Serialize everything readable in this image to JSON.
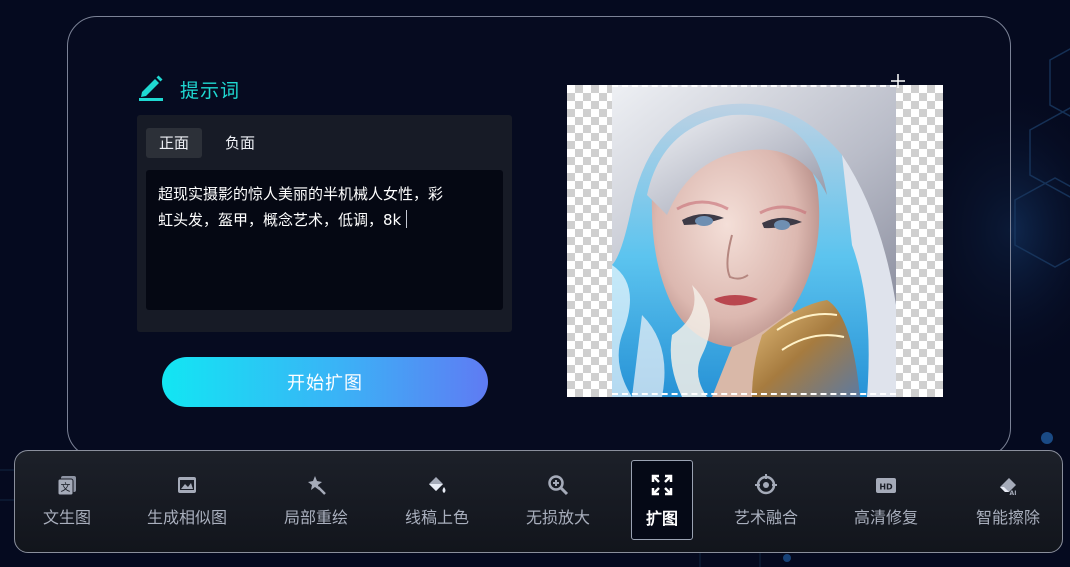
{
  "prompt": {
    "title": "提示词",
    "title_icon": "edit-icon",
    "tabs": [
      {
        "label": "正面",
        "active": true
      },
      {
        "label": "负面",
        "active": false
      }
    ],
    "text_line1": "超现实摄影的惊人美丽的半机械人女性，彩",
    "text_line2": "虹头发，盔甲，概念艺术，低调，8k"
  },
  "action": {
    "start_label": "开始扩图"
  },
  "preview": {
    "image": "portrait of a cyborg woman with silver hair",
    "background": "transparency-checkerboard"
  },
  "toolbar": {
    "items": [
      {
        "label": "文生图",
        "icon": "text-to-image-icon",
        "active": false
      },
      {
        "label": "生成相似图",
        "icon": "similar-image-icon",
        "active": false
      },
      {
        "label": "局部重绘",
        "icon": "magic-brush-icon",
        "active": false
      },
      {
        "label": "线稿上色",
        "icon": "paint-bucket-icon",
        "active": false
      },
      {
        "label": "无损放大",
        "icon": "zoom-in-icon",
        "active": false
      },
      {
        "label": "扩图",
        "icon": "expand-icon",
        "active": true
      },
      {
        "label": "艺术融合",
        "icon": "fusion-icon",
        "active": false
      },
      {
        "label": "高清修复",
        "icon": "hd-icon",
        "active": false
      },
      {
        "label": "智能擦除",
        "icon": "eraser-icon",
        "active": false
      }
    ]
  },
  "colors": {
    "accent": "#1fd9d2",
    "background": "#050a1f",
    "button_start": "#12e6f3",
    "button_end": "#5f7bf3"
  }
}
